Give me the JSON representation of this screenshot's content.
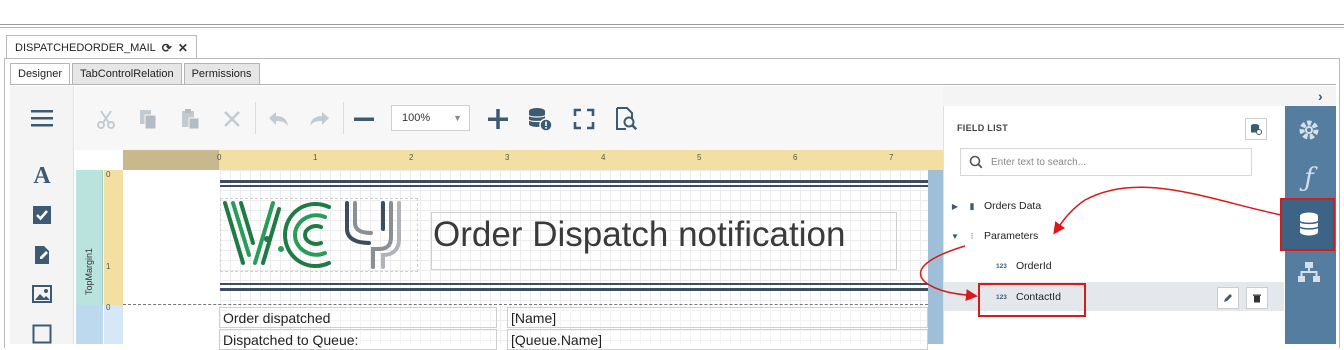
{
  "document_tab": {
    "title": "DISPATCHEDORDER_MAIL"
  },
  "subtabs": [
    "Designer",
    "TabControlRelation",
    "Permissions"
  ],
  "toolbar": {
    "zoom_value": "100%"
  },
  "ruler": {
    "ticks": [
      "0",
      "1",
      "2",
      "3",
      "4",
      "5",
      "6",
      "7"
    ],
    "v_ticks": [
      "0",
      "1",
      "0"
    ]
  },
  "bands": {
    "top_margin": "TopMargin1"
  },
  "report": {
    "title": "Order Dispatch notification",
    "rows": [
      {
        "label": "Order dispatched",
        "value": "[Name]"
      },
      {
        "label": "Dispatched to Queue:",
        "value": "[Queue.Name]"
      }
    ]
  },
  "field_list": {
    "heading": "FIELD LIST",
    "search_placeholder": "Enter text to search...",
    "items": [
      {
        "label": "Orders Data",
        "type_icon": "database-icon"
      },
      {
        "label": "Parameters",
        "type_icon": "parameters-icon"
      },
      {
        "label": "OrderId",
        "type_icon": "number-icon",
        "type_text": "123"
      },
      {
        "label": "ContactId",
        "type_icon": "number-icon",
        "type_text": "123"
      }
    ]
  },
  "colors": {
    "accent": "#547d9f",
    "accent_active": "#3d6385",
    "annotation": "#d71a1a",
    "ruler": "#f3dfa1"
  }
}
